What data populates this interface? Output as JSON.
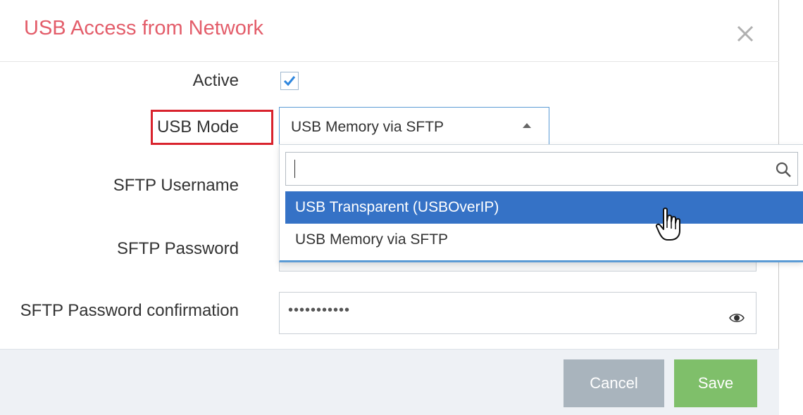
{
  "dialog": {
    "title": "USB Access from Network",
    "close_icon": "close-icon",
    "title_color": "#e35d6a"
  },
  "form": {
    "active_label": "Active",
    "active_checked": true,
    "usb_mode_label": "USB Mode",
    "usb_mode_value": "USB Memory via SFTP",
    "sftp_username_label": "SFTP Username",
    "sftp_password_label": "SFTP Password",
    "sftp_password_confirm_label": "SFTP Password confirmation",
    "sftp_password_confirm_value": "•••••••••••"
  },
  "dropdown": {
    "search_value": "",
    "search_icon": "search-icon",
    "options": [
      {
        "label": "USB Transparent (USBOverIP)",
        "highlighted": true
      },
      {
        "label": "USB Memory via SFTP",
        "highlighted": false
      }
    ]
  },
  "footer": {
    "cancel_label": "Cancel",
    "save_label": "Save"
  },
  "colors": {
    "accent_blue": "#3572c6",
    "save_green": "#7fbf6a",
    "cancel_gray": "#a9b4bd",
    "highlight_red": "#d9232d"
  }
}
